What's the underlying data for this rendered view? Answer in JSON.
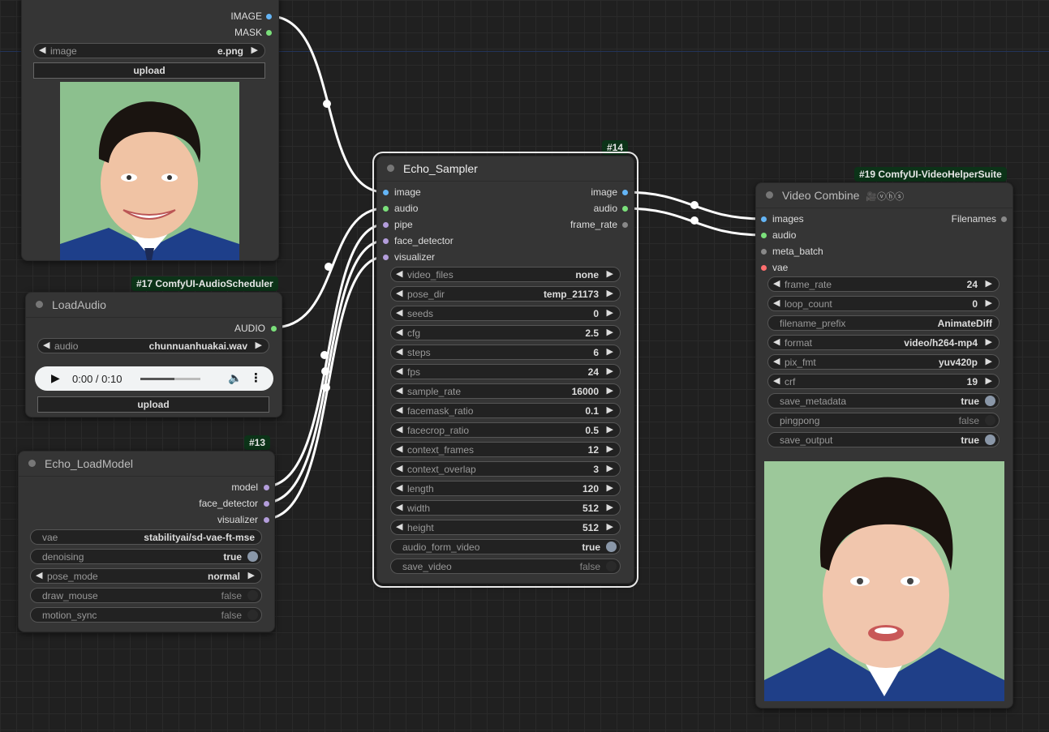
{
  "load_image": {
    "outputs": [
      "IMAGE",
      "MASK"
    ],
    "image_widget": {
      "label": "image",
      "value": "e.png"
    },
    "upload_label": "upload"
  },
  "load_audio": {
    "badge": "#17 ComfyUI-AudioScheduler",
    "title": "LoadAudio",
    "output": "AUDIO",
    "audio_widget": {
      "label": "audio",
      "value": "chunnuanhuakai.wav"
    },
    "player_time": "0:00 / 0:10",
    "upload_label": "upload"
  },
  "load_model": {
    "badge": "#13",
    "title": "Echo_LoadModel",
    "outputs": [
      "model",
      "face_detector",
      "visualizer"
    ],
    "widgets": [
      {
        "label": "vae",
        "value": "stabilityai/sd-vae-ft-mse",
        "kind": "text"
      },
      {
        "label": "denoising",
        "value": "true",
        "kind": "toggle",
        "on": true
      },
      {
        "label": "pose_mode",
        "value": "normal",
        "kind": "combo"
      },
      {
        "label": "draw_mouse",
        "value": "false",
        "kind": "toggle",
        "on": false
      },
      {
        "label": "motion_sync",
        "value": "false",
        "kind": "toggle",
        "on": false
      }
    ]
  },
  "sampler": {
    "badge": "#14",
    "title": "Echo_Sampler",
    "inputs": [
      "image",
      "audio",
      "pipe",
      "face_detector",
      "visualizer"
    ],
    "outputs": [
      "image",
      "audio",
      "frame_rate"
    ],
    "widgets": [
      {
        "label": "video_files",
        "value": "none",
        "kind": "combo"
      },
      {
        "label": "pose_dir",
        "value": "temp_21173",
        "kind": "combo"
      },
      {
        "label": "seeds",
        "value": "0",
        "kind": "combo"
      },
      {
        "label": "cfg",
        "value": "2.5",
        "kind": "combo"
      },
      {
        "label": "steps",
        "value": "6",
        "kind": "combo"
      },
      {
        "label": "fps",
        "value": "24",
        "kind": "combo"
      },
      {
        "label": "sample_rate",
        "value": "16000",
        "kind": "combo"
      },
      {
        "label": "facemask_ratio",
        "value": "0.1",
        "kind": "combo"
      },
      {
        "label": "facecrop_ratio",
        "value": "0.5",
        "kind": "combo"
      },
      {
        "label": "context_frames",
        "value": "12",
        "kind": "combo"
      },
      {
        "label": "context_overlap",
        "value": "3",
        "kind": "combo"
      },
      {
        "label": "length",
        "value": "120",
        "kind": "combo"
      },
      {
        "label": "width",
        "value": "512",
        "kind": "combo"
      },
      {
        "label": "height",
        "value": "512",
        "kind": "combo"
      },
      {
        "label": "audio_form_video",
        "value": "true",
        "kind": "toggle",
        "on": true
      },
      {
        "label": "save_video",
        "value": "false",
        "kind": "toggle",
        "on": false
      }
    ]
  },
  "video_combine": {
    "badge": "#19 ComfyUI-VideoHelperSuite",
    "title": "Video Combine",
    "title_glyphs": "🎥ⓥⓗⓢ",
    "inputs": [
      "images",
      "audio",
      "meta_batch",
      "vae"
    ],
    "output": "Filenames",
    "widgets": [
      {
        "label": "frame_rate",
        "value": "24",
        "kind": "combo"
      },
      {
        "label": "loop_count",
        "value": "0",
        "kind": "combo"
      },
      {
        "label": "filename_prefix",
        "value": "AnimateDiff",
        "kind": "text"
      },
      {
        "label": "format",
        "value": "video/h264-mp4",
        "kind": "combo"
      },
      {
        "label": "pix_fmt",
        "value": "yuv420p",
        "kind": "combo"
      },
      {
        "label": "crf",
        "value": "19",
        "kind": "combo"
      },
      {
        "label": "save_metadata",
        "value": "true",
        "kind": "toggle",
        "on": true
      },
      {
        "label": "pingpong",
        "value": "false",
        "kind": "toggle",
        "on": false
      },
      {
        "label": "save_output",
        "value": "true",
        "kind": "toggle",
        "on": true
      }
    ]
  },
  "colors": {
    "image": "#64b5f6",
    "audio": "#7be07b",
    "pipe": "#b39ddb",
    "vae": "#ff6e6e",
    "other": "#888888"
  }
}
